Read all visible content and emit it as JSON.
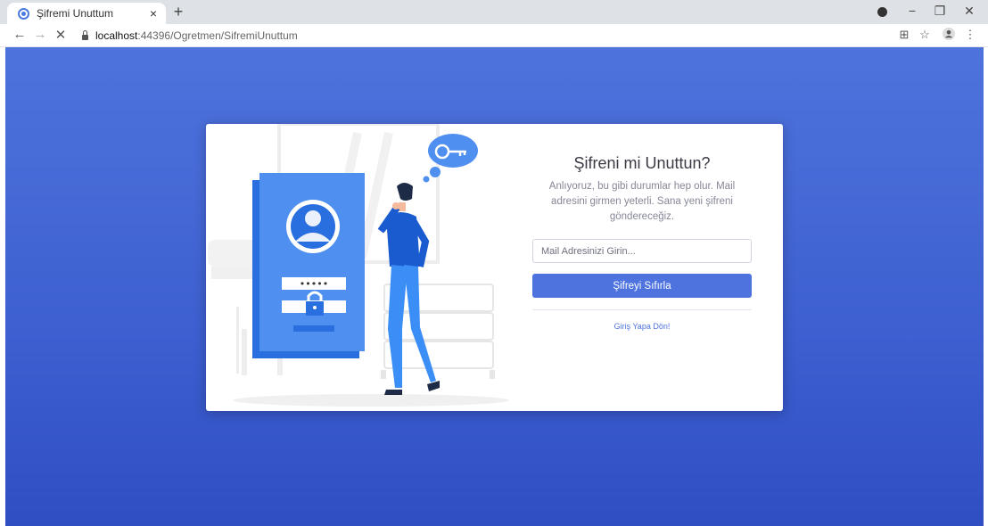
{
  "browser": {
    "tab_title": "Şifremi Unuttum",
    "tab_close": "×",
    "new_tab": "+",
    "url_host": "localhost",
    "url_path": ":44396/Ogretmen/SifremiUnuttum",
    "window_controls": {
      "minimize": "−",
      "restore": "❐",
      "close": "✕"
    },
    "nav": {
      "back": "←",
      "forward": "→",
      "stop": "✕"
    },
    "toolbar_icons": {
      "translate": "⊞",
      "bookmark": "☆",
      "menu": "⋮"
    }
  },
  "colors": {
    "accent": "#4e73df",
    "background_top": "#4e73dc",
    "background_bottom": "#2f4ec2"
  },
  "form": {
    "title": "Şifreni mi Unuttun?",
    "description": "Anlıyoruz, bu gibi durumlar hep olur. Mail adresini girmen yeterli. Sana yeni şifreni göndereceğiz.",
    "email_placeholder": "Mail Adresinizi Girin...",
    "reset_button": "Şifreyi Sıfırla",
    "back_link": "Giriş Yapa Dön!"
  },
  "illustration": {
    "icons": [
      "key-icon",
      "user-avatar-icon",
      "padlock-icon"
    ],
    "password_mask": "•••••"
  }
}
